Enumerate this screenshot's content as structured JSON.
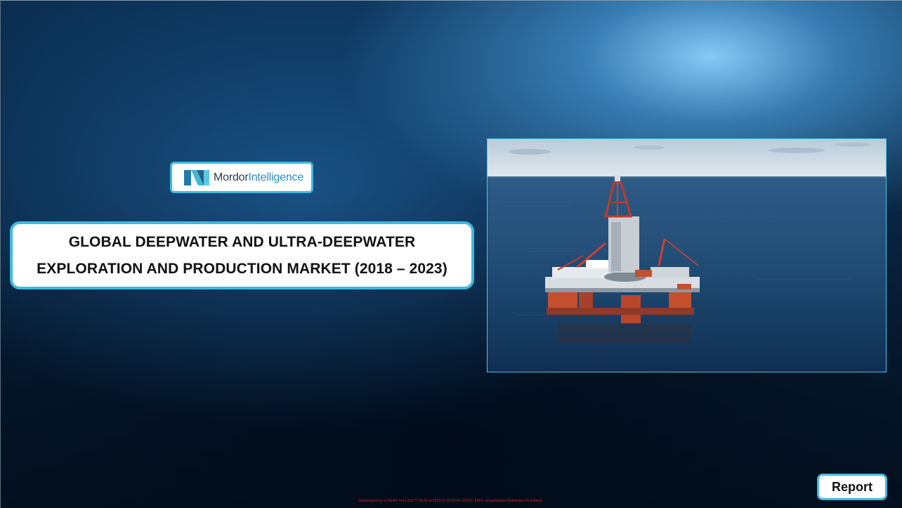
{
  "logo": {
    "brand_first": "Mordor",
    "brand_second": "Intelligence",
    "icon": "mordor-intelligence-logo-icon"
  },
  "title": {
    "line1": "GLOBAL DEEPWATER AND ULTRA-DEEPWATER",
    "line2": "EXPLORATION AND PRODUCTION MARKET (2018 – 2023)"
  },
  "photo": {
    "subject": "offshore-drilling-rig-photo"
  },
  "report_button": {
    "label": "Report"
  },
  "footer": {
    "notice": "Downloaded by cn-6ee07 from 218.77.64.50 at 2019-07-23 00:54:16 EST. EMIS. Unauthorized Distribution Prohibited."
  },
  "colors": {
    "accent": "#3fb8e0",
    "brand_blue": "#2a8fc4",
    "footer_red": "#e0201c"
  }
}
